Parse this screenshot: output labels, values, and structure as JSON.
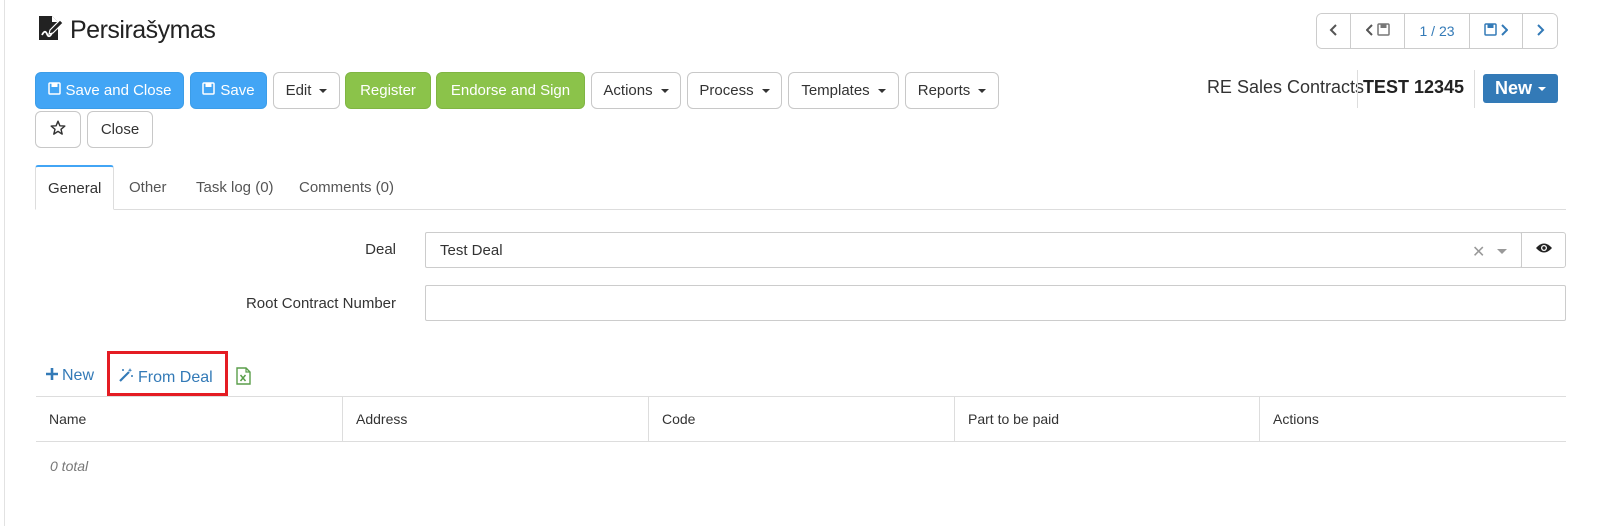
{
  "title": "Persirašymas",
  "pager": {
    "position": "1 / 23"
  },
  "toolbar": {
    "save_close": "Save and Close",
    "save": "Save",
    "edit": "Edit",
    "register": "Register",
    "endorse": "Endorse and Sign",
    "actions": "Actions",
    "process": "Process",
    "templates": "Templates",
    "reports": "Reports",
    "close": "Close"
  },
  "header_right": {
    "module": "RE Sales Contracts",
    "record": "TEST 12345",
    "new_label": "New"
  },
  "tabs": [
    {
      "label": "General"
    },
    {
      "label": "Other"
    },
    {
      "label": "Task log (0)"
    },
    {
      "label": "Comments (0)"
    }
  ],
  "form": {
    "deal_label": "Deal",
    "deal_value": "Test Deal",
    "root_label": "Root Contract Number",
    "root_value": ""
  },
  "grid": {
    "new_label": "New",
    "from_deal_label": "From Deal",
    "columns": [
      "Name",
      "Address",
      "Code",
      "Part to be paid",
      "Actions"
    ],
    "total": "0 total"
  },
  "colors": {
    "primary": "#42a5f5",
    "success": "#8bc34a",
    "link": "#337ab7",
    "highlight": "#e41c23"
  }
}
